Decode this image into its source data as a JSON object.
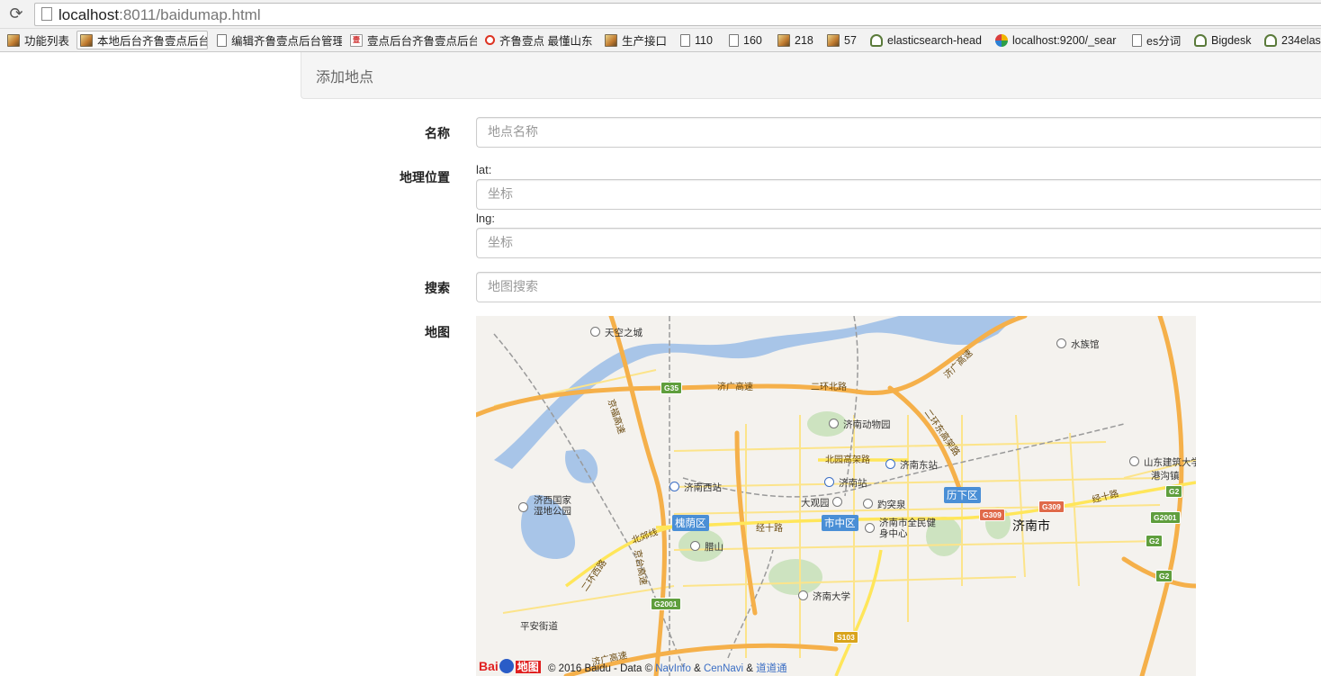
{
  "browser": {
    "url_host": "localhost",
    "url_port": ":8011",
    "url_path": "/baidumap.html",
    "bookmarks": [
      {
        "label": "功能列表",
        "icon": "image-icon"
      },
      {
        "label": "本地后台齐鲁壹点后台",
        "icon": "image-icon"
      },
      {
        "label": "编辑齐鲁壹点后台管理",
        "icon": "page-icon"
      },
      {
        "label": "壹点后台齐鲁壹点后台",
        "icon": "site-icon"
      },
      {
        "label": "齐鲁壹点 最懂山东",
        "icon": "pin-icon"
      },
      {
        "label": "生产接口",
        "icon": "image-icon"
      },
      {
        "label": "110",
        "icon": "page-icon"
      },
      {
        "label": "160",
        "icon": "page-icon"
      },
      {
        "label": "218",
        "icon": "image-icon"
      },
      {
        "label": "57",
        "icon": "image-icon"
      },
      {
        "label": "elasticsearch-head",
        "icon": "ext-icon"
      },
      {
        "label": "localhost:9200/_sear",
        "icon": "elastic-icon"
      },
      {
        "label": "es分词",
        "icon": "page-icon"
      },
      {
        "label": "Bigdesk",
        "icon": "ext-icon"
      },
      {
        "label": "234elas",
        "icon": "ext-icon"
      }
    ]
  },
  "panel": {
    "title": "添加地点"
  },
  "form": {
    "name_label": "名称",
    "name_placeholder": "地点名称",
    "location_label": "地理位置",
    "lat_label": "lat:",
    "lat_placeholder": "坐标",
    "lng_label": "lng:",
    "lng_placeholder": "坐标",
    "search_label": "搜索",
    "search_placeholder": "地图搜索",
    "map_label": "地图"
  },
  "map": {
    "city": "济南市",
    "districts": [
      "槐荫区",
      "市中区",
      "历下区"
    ],
    "places": [
      "天空之城",
      "水族馆",
      "济南动物园",
      "济南东站",
      "济南西站",
      "济南站",
      "大观园",
      "趵突泉",
      "济南市全民健身中心",
      "济西国家湿地公园",
      "腊山",
      "济南大学",
      "平安街道",
      "山东建筑大学",
      "港沟镇"
    ],
    "roads": [
      "济广高速",
      "京福高速",
      "二环北路",
      "北园高架路",
      "经十路",
      "北郊线",
      "济广高速",
      "二环东高架路",
      "京台高速",
      "济广高速",
      "经十路",
      "二环西路"
    ],
    "shields": [
      "G35",
      "G2001",
      "S103",
      "G309",
      "G309",
      "G2",
      "G2001",
      "G2",
      "G2"
    ],
    "copyright_year": "© 2016 Baidu - Data ©",
    "data_link_1": "NavInfo",
    "data_sep_1": "&",
    "data_link_2": "CenNavi",
    "data_sep_2": "&",
    "data_link_3": "道道通",
    "logo_text_1": "Bai",
    "logo_text_2": "地图",
    "colors": {
      "water": "#a8c5e8",
      "highway": "#f5b04a",
      "road": "#fce48a",
      "park": "#cde3c0",
      "land": "#f4f2ee"
    }
  }
}
